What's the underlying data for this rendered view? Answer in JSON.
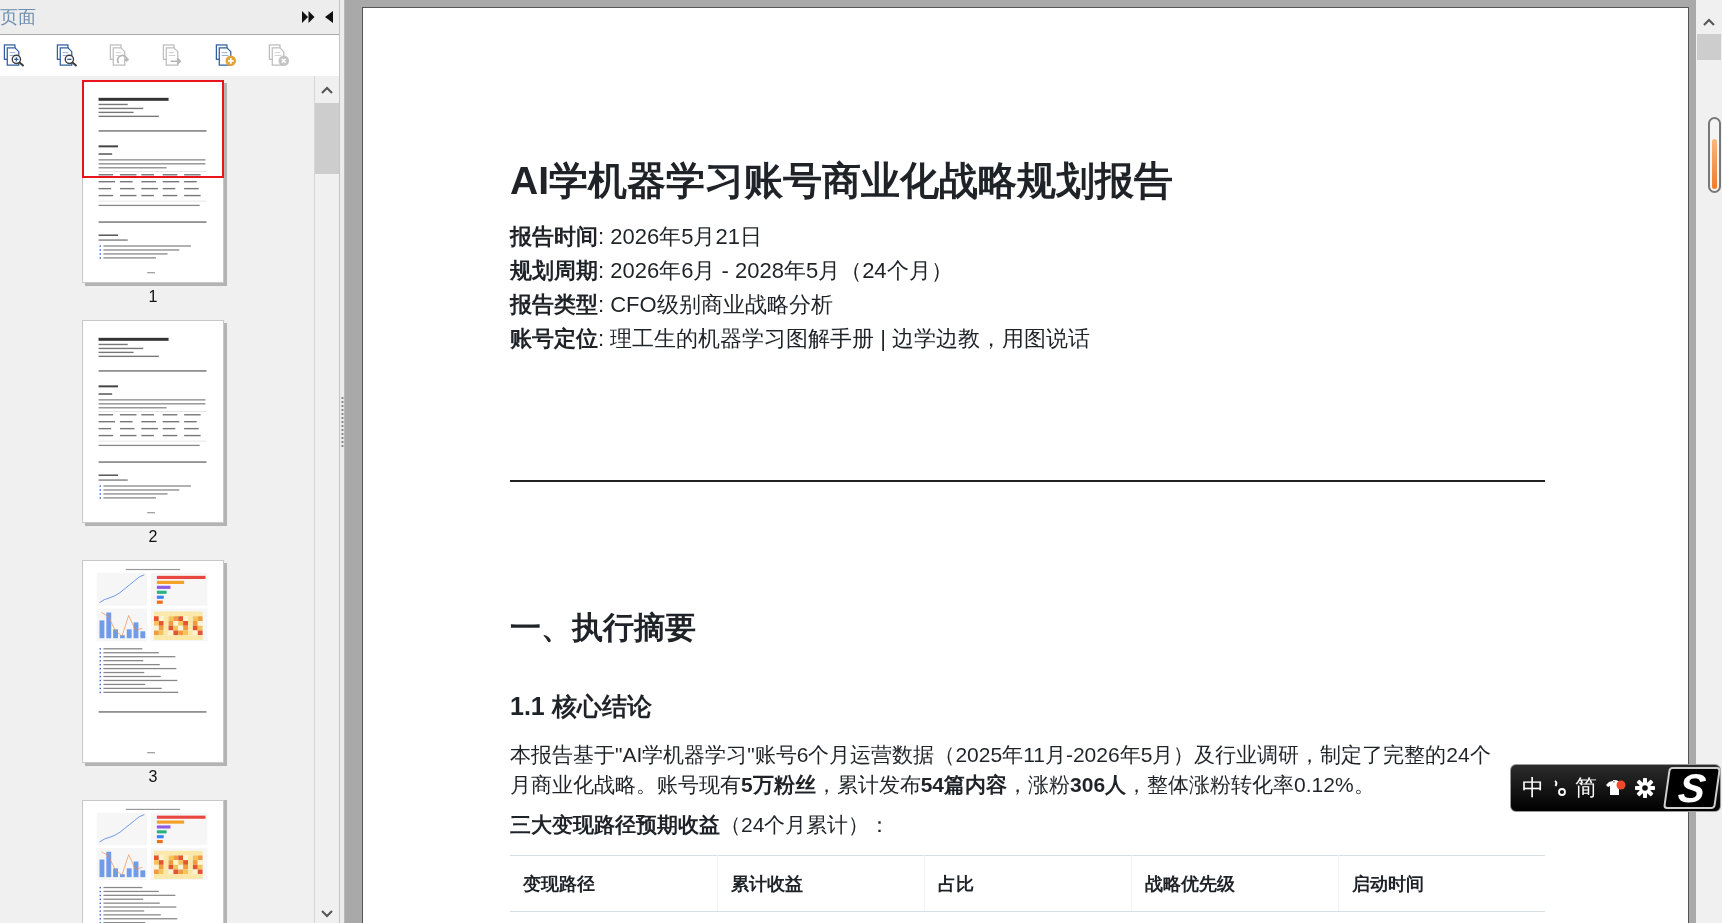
{
  "side_panel": {
    "title": "页面",
    "tools": [
      {
        "kind": "zoom_in",
        "disabled": false
      },
      {
        "kind": "zoom_out",
        "disabled": false
      },
      {
        "kind": "rotate",
        "disabled": true
      },
      {
        "kind": "move",
        "disabled": true
      },
      {
        "kind": "insert",
        "disabled": false
      },
      {
        "kind": "delete",
        "disabled": true
      }
    ],
    "thumbnails": [
      {
        "label": "1",
        "selected": true,
        "kind": "text"
      },
      {
        "label": "2",
        "selected": false,
        "kind": "text"
      },
      {
        "label": "3",
        "selected": false,
        "kind": "charts"
      },
      {
        "selected": false,
        "kind": "charts"
      }
    ]
  },
  "document": {
    "title": "AI学机器学习账号商业化战略规划报告",
    "meta": [
      "**报告时间**: 2026年5月21日",
      "**规划周期**: 2026年6月 - 2028年5月（24个月）",
      "**报告类型**: CFO级别商业战略分析",
      "**账号定位**: 理工生的机器学习图解手册 | 边学边教，用图说话"
    ],
    "heading": "一、执行摘要",
    "subheading": "1.1 核心结论",
    "paragraphs": [
      "本报告基于\"AI学机器学习\"账号6个月运营数据（2025年11月-2026年5月）及行业调研，制定了完整的24个月商业化战略。账号现有**5万粉丝**，累计发布**54篇内容**，涨粉**306人**，整体涨粉转化率0.12%。",
      "**三大变现路径预期收益**（24个月累计）："
    ],
    "table": {
      "columns": [
        "变现路径",
        "累计收益",
        "占比",
        "战略优先级",
        "启动时间"
      ]
    }
  },
  "ime_toolbar": {
    "mode": "中",
    "script": "简",
    "logo": "S"
  }
}
